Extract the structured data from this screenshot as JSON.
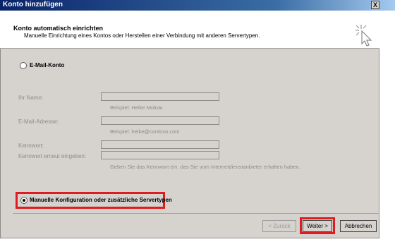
{
  "window": {
    "title": "Konto hinzufügen",
    "close_glyph": "X"
  },
  "header": {
    "title": "Konto automatisch einrichten",
    "subtitle": "Manuelle Einrichtung eines Kontos oder Herstellen einer Verbindung mit anderen Servertypen.",
    "icon": "wizard-cursor-icon"
  },
  "email_option": {
    "label": "E-Mail-Konto",
    "selected": false
  },
  "fields": {
    "name_label": "Ihr Name:",
    "name_value": "",
    "name_hint": "Beispiel: Heike Molnar",
    "email_label": "E-Mail-Adresse:",
    "email_value": "",
    "email_hint": "Beispiel: heike@contoso.com",
    "password_label": "Kennwort:",
    "password_value": "",
    "password_repeat_label": "Kennwort erneut eingeben:",
    "password_repeat_value": "",
    "password_hint": "Geben Sie das Kennwort ein, das Sie vom Internetdienstanbieter erhalten haben."
  },
  "manual_option": {
    "label": "Manuelle Konfiguration oder zusätzliche Servertypen",
    "selected": true
  },
  "buttons": {
    "back": "< Zurück",
    "next": "Weiter >",
    "cancel": "Abbrechen"
  },
  "colors": {
    "highlight": "#e11b22",
    "dialog_bg": "#d6d3ce"
  }
}
